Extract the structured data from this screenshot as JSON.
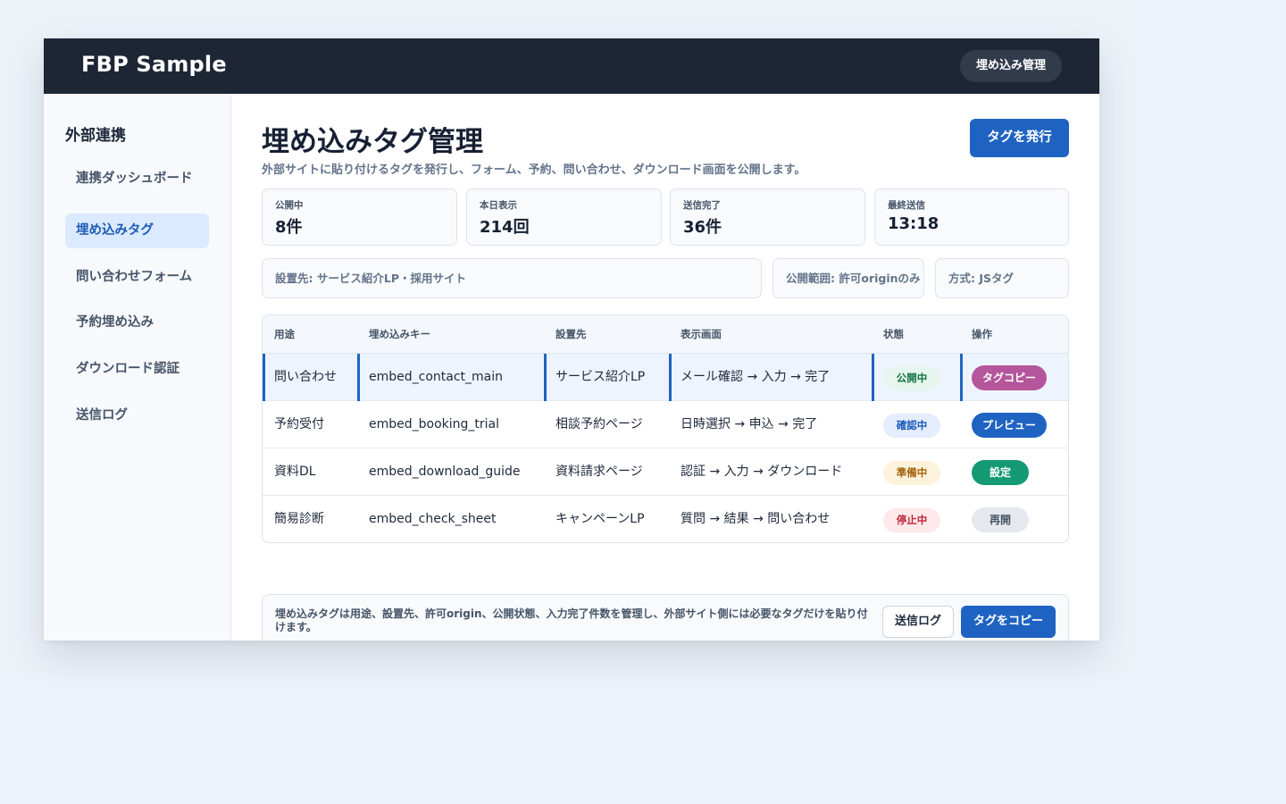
{
  "app": {
    "brand": "FBP Sample",
    "top_pill": "埋め込み管理"
  },
  "sidebar": {
    "title": "外部連携",
    "items": [
      {
        "label": "連携ダッシュボード"
      },
      {
        "label": "埋め込みタグ"
      },
      {
        "label": "問い合わせフォーム"
      },
      {
        "label": "予約埋め込み"
      },
      {
        "label": "ダウンロード認証"
      },
      {
        "label": "送信ログ"
      }
    ],
    "active_index": 1
  },
  "header": {
    "title": "埋め込みタグ管理",
    "subtitle": "外部サイトに貼り付けるタグを発行し、フォーム、予約、問い合わせ、ダウンロード画面を公開します。",
    "primary_button": "タグを発行"
  },
  "stats": [
    {
      "label": "公開中",
      "value": "8件"
    },
    {
      "label": "本日表示",
      "value": "214回"
    },
    {
      "label": "送信完了",
      "value": "36件"
    },
    {
      "label": "最終送信",
      "value": "13:18"
    }
  ],
  "filters": {
    "placement": "設置先: サービス紹介LP・採用サイト",
    "scope": "公開範囲: 許可originのみ",
    "method": "方式: JSタグ"
  },
  "table": {
    "headers": [
      "用途",
      "埋め込みキー",
      "設置先",
      "表示画面",
      "状態",
      "操作"
    ],
    "rows": [
      {
        "purpose": "問い合わせ",
        "key": "embed_contact_main",
        "place": "サービス紹介LP",
        "flow": "メール確認 → 入力 → 完了",
        "status": "公開中",
        "action": "タグコピー"
      },
      {
        "purpose": "予約受付",
        "key": "embed_booking_trial",
        "place": "相談予約ページ",
        "flow": "日時選択 → 申込 → 完了",
        "status": "確認中",
        "action": "プレビュー"
      },
      {
        "purpose": "資料DL",
        "key": "embed_download_guide",
        "place": "資料請求ページ",
        "flow": "認証 → 入力 → ダウンロード",
        "status": "準備中",
        "action": "設定"
      },
      {
        "purpose": "簡易診断",
        "key": "embed_check_sheet",
        "place": "キャンペーンLP",
        "flow": "質問 → 結果 → 問い合わせ",
        "status": "停止中",
        "action": "再開"
      }
    ]
  },
  "footer": {
    "note": "埋め込みタグは用途、設置先、許可origin、公開状態、入力完了件数を管理し、外部サイト側には必要なタグだけを貼り付けます。",
    "log_button": "送信ログ",
    "copy_button": "タグをコピー"
  },
  "colors": {
    "topbar": "#1e2636",
    "accent": "#1f63c2",
    "status_green": "#157347",
    "status_blue": "#1e5bb8",
    "status_amber": "#a3620a",
    "status_red": "#c0283a",
    "action_pink": "#b5559b",
    "action_teal": "#149a73"
  }
}
